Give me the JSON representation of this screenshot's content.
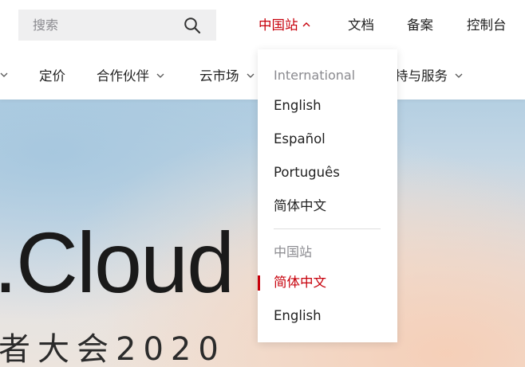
{
  "search": {
    "placeholder": "搜索",
    "icon": "search-icon"
  },
  "top_links": {
    "region": "中国站",
    "docs": "文档",
    "record": "备案",
    "console": "控制台"
  },
  "nav": {
    "pricing": "定价",
    "partners": "合作伙伴",
    "marketplace": "云市场",
    "support": "持与服务"
  },
  "region_menu": {
    "international": {
      "title": "International",
      "items": [
        "English",
        "Español",
        "Português",
        "简体中文"
      ]
    },
    "china": {
      "title": "中国站",
      "items": [
        "简体中文",
        "English"
      ],
      "selected": "简体中文"
    }
  },
  "hero": {
    "title": ".Cloud",
    "subtitle": "者大会2020"
  },
  "colors": {
    "accent": "#c7000b",
    "text": "#1f1f1f",
    "muted": "#8a8a8f",
    "search_bg": "#efeff0"
  }
}
